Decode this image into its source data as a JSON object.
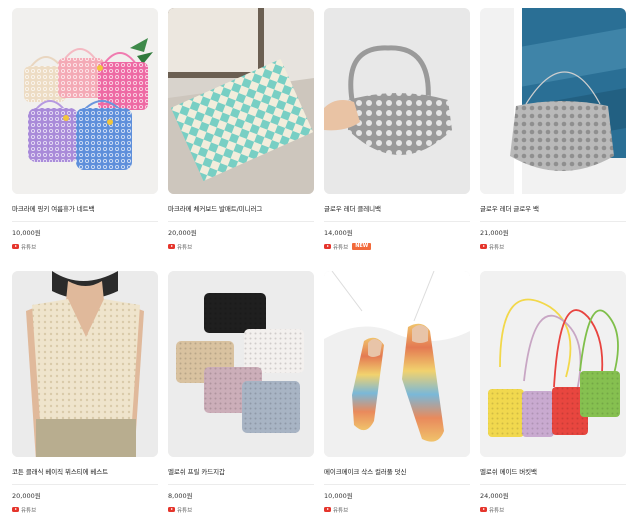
{
  "products": [
    {
      "title": "마크라메 핑키 여름휴가 네트백",
      "price": "10,000원",
      "youtube_label": "유튜브",
      "badge": ""
    },
    {
      "title": "마크라메 체커보드 발매트/미니러그",
      "price": "20,000원",
      "youtube_label": "유튜브",
      "badge": ""
    },
    {
      "title": "글로우 레더 클레니백",
      "price": "14,000원",
      "youtube_label": "유튜브",
      "badge": "NEW"
    },
    {
      "title": "글로우 레더 글로우 백",
      "price": "21,000원",
      "youtube_label": "유튜브",
      "badge": ""
    },
    {
      "title": "코튼 클래식 베이직 뷔스티에 베스트",
      "price": "20,000원",
      "youtube_label": "유튜브",
      "badge": ""
    },
    {
      "title": "멜로쉬 프릴 카드지갑",
      "price": "8,000원",
      "youtube_label": "유튜브",
      "badge": ""
    },
    {
      "title": "메이크메이크 삭스 컬러풀 덧신",
      "price": "10,000원",
      "youtube_label": "유튜브",
      "badge": ""
    },
    {
      "title": "멜로쉬 메이드 버킷백",
      "price": "24,000원",
      "youtube_label": "유튜브",
      "badge": ""
    }
  ],
  "colors": {
    "new_badge": "#f26a3b",
    "youtube_red": "#e5352c"
  }
}
